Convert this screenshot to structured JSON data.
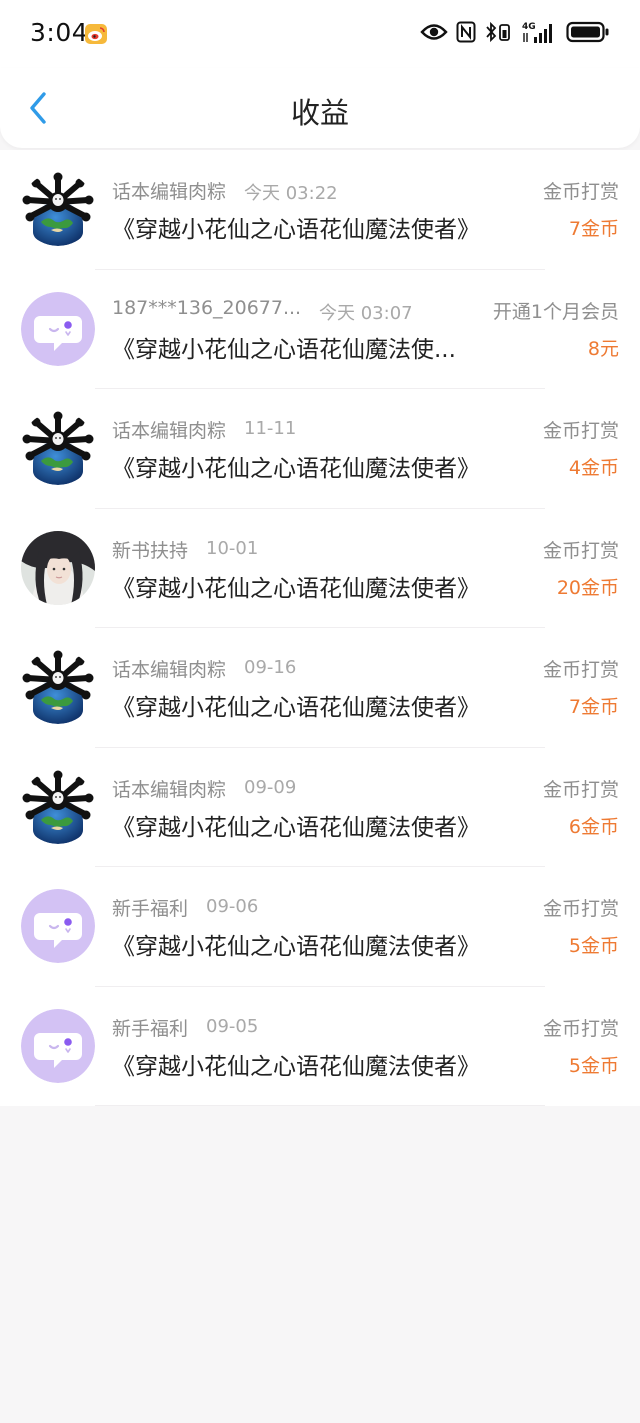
{
  "status_bar": {
    "time": "3:04",
    "network": "4G"
  },
  "header": {
    "title": "收益"
  },
  "colors": {
    "accent_blue": "#2f9be8",
    "amount_orange": "#ee7a33",
    "avatar_purple": "#d3c2f4"
  },
  "records": [
    {
      "name": "话本编辑肉粽",
      "time": "今天 03:22",
      "type": "金币打赏",
      "book": "《穿越小花仙之心语花仙魔法使者》",
      "amount": "7金币",
      "avatar": "cartoon-avatar"
    },
    {
      "name": "187***136_20677...",
      "time": "今天 03:07",
      "type": "开通1个月会员",
      "book": "《穿越小花仙之心语花仙魔法使...",
      "amount": "8元",
      "avatar": "default-chat-avatar"
    },
    {
      "name": "话本编辑肉粽",
      "time": "11-11",
      "type": "金币打赏",
      "book": "《穿越小花仙之心语花仙魔法使者》",
      "amount": "4金币",
      "avatar": "cartoon-avatar"
    },
    {
      "name": "新书扶持",
      "time": "10-01",
      "type": "金币打赏",
      "book": "《穿越小花仙之心语花仙魔法使者》",
      "amount": "20金币",
      "avatar": "portrait-avatar"
    },
    {
      "name": "话本编辑肉粽",
      "time": "09-16",
      "type": "金币打赏",
      "book": "《穿越小花仙之心语花仙魔法使者》",
      "amount": "7金币",
      "avatar": "cartoon-avatar"
    },
    {
      "name": "话本编辑肉粽",
      "time": "09-09",
      "type": "金币打赏",
      "book": "《穿越小花仙之心语花仙魔法使者》",
      "amount": "6金币",
      "avatar": "cartoon-avatar"
    },
    {
      "name": "新手福利",
      "time": "09-06",
      "type": "金币打赏",
      "book": "《穿越小花仙之心语花仙魔法使者》",
      "amount": "5金币",
      "avatar": "default-chat-avatar"
    },
    {
      "name": "新手福利",
      "time": "09-05",
      "type": "金币打赏",
      "book": "《穿越小花仙之心语花仙魔法使者》",
      "amount": "5金币",
      "avatar": "default-chat-avatar"
    }
  ]
}
